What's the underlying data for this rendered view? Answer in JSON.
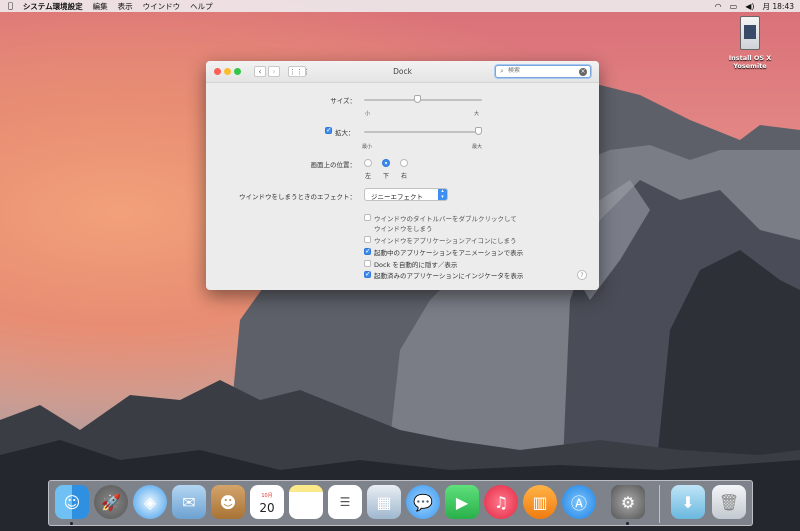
{
  "menubar": {
    "app_name": "システム環境設定",
    "menus": [
      "編集",
      "表示",
      "ウインドウ",
      "ヘルプ"
    ],
    "clock": "月 18:43",
    "status_icons": [
      "wifi-icon",
      "display-icon",
      "volume-icon"
    ]
  },
  "desktop": {
    "icon_label_1": "Install OS X",
    "icon_label_2": "Yosemite"
  },
  "window": {
    "title": "Dock",
    "search_placeholder": "検索",
    "size_label": "サイズ：",
    "size_min": "小",
    "size_max": "大",
    "size_value": 0.45,
    "magnify_label": "拡大：",
    "magnify_checked": true,
    "magnify_min": "最小",
    "magnify_max": "最大",
    "magnify_value": 1.0,
    "position_label": "画面上の位置：",
    "position_options": [
      "左",
      "下",
      "右"
    ],
    "position_selected": "下",
    "minimize_label": "ウインドウをしまうときのエフェクト：",
    "minimize_value": "ジニーエフェクト",
    "options": [
      {
        "label_lines": [
          "ウインドウのタイトルバーをダブルクリックして",
          "ウインドウをしまう"
        ],
        "checked": false
      },
      {
        "label_lines": [
          "ウインドウをアプリケーションアイコンにしまう"
        ],
        "checked": false
      },
      {
        "label_lines": [
          "起動中のアプリケーションをアニメーションで表示"
        ],
        "checked": true
      },
      {
        "label_lines": [
          "Dock を自動的に隠す／表示"
        ],
        "checked": false
      },
      {
        "label_lines": [
          "起動済みのアプリケーションにインジケータを表示"
        ],
        "checked": true
      }
    ],
    "help": "?"
  },
  "dock": {
    "calendar_month": "10月",
    "calendar_day": "20",
    "items": [
      "finder",
      "launchpad",
      "safari",
      "mail",
      "contacts",
      "calendar",
      "notes",
      "reminders",
      "photos",
      "messages",
      "facetime",
      "itunes",
      "ibooks",
      "app-store",
      "system-preferences",
      "downloads",
      "trash"
    ]
  }
}
